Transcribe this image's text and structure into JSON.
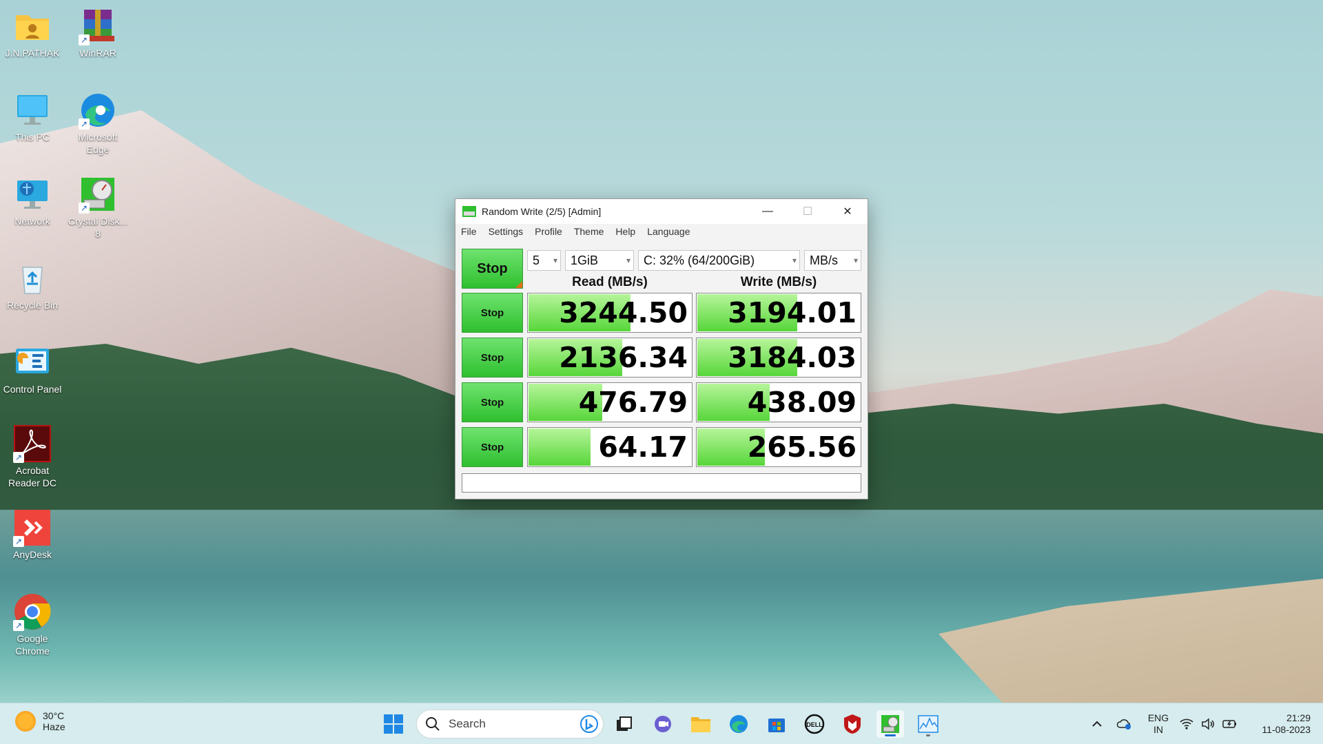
{
  "desktop": {
    "icons": [
      {
        "label": "J.N.PATHAK",
        "icon": "user-folder-icon"
      },
      {
        "label": "WinRAR",
        "icon": "winrar-icon"
      },
      {
        "label": "This PC",
        "icon": "monitor-icon"
      },
      {
        "label": "Microsoft Edge",
        "icon": "edge-icon"
      },
      {
        "label": "Network",
        "icon": "network-icon"
      },
      {
        "label": "Crystal Disk... 8",
        "icon": "crystaldisk-icon"
      },
      {
        "label": "Recycle Bin",
        "icon": "recycle-bin-icon"
      },
      {
        "label": "Control Panel",
        "icon": "control-panel-icon"
      },
      {
        "label": "Acrobat Reader DC",
        "icon": "acrobat-icon"
      },
      {
        "label": "AnyDesk",
        "icon": "anydesk-icon"
      },
      {
        "label": "Google Chrome",
        "icon": "chrome-icon"
      }
    ]
  },
  "window": {
    "title": "Random Write (2/5) [Admin]",
    "menu": [
      "File",
      "Settings",
      "Profile",
      "Theme",
      "Help",
      "Language"
    ],
    "stop_all_label": "Stop",
    "count": "5",
    "size": "1GiB",
    "drive": "C: 32% (64/200GiB)",
    "unit": "MB/s",
    "read_header": "Read (MB/s)",
    "write_header": "Write (MB/s)",
    "rows": [
      {
        "button": "Stop",
        "read": "3244.50",
        "write": "3194.01",
        "read_fill": 0.62,
        "write_fill": 0.61
      },
      {
        "button": "Stop",
        "read": "2136.34",
        "write": "3184.03",
        "read_fill": 0.57,
        "write_fill": 0.61
      },
      {
        "button": "Stop",
        "read": "476.79",
        "write": "438.09",
        "read_fill": 0.45,
        "write_fill": 0.44
      },
      {
        "button": "Stop",
        "read": "64.17",
        "write": "265.56",
        "read_fill": 0.38,
        "write_fill": 0.41
      }
    ],
    "status_text": ""
  },
  "taskbar": {
    "weather_temp": "30°C",
    "weather_desc": "Haze",
    "search_placeholder": "Search",
    "lang_top": "ENG",
    "lang_bottom": "IN",
    "time": "21:29",
    "date": "11-08-2023"
  },
  "colors": {
    "green_button": "#2fbf2f",
    "bar_fill": "#57d63a",
    "taskbar": "#d6ecee"
  }
}
